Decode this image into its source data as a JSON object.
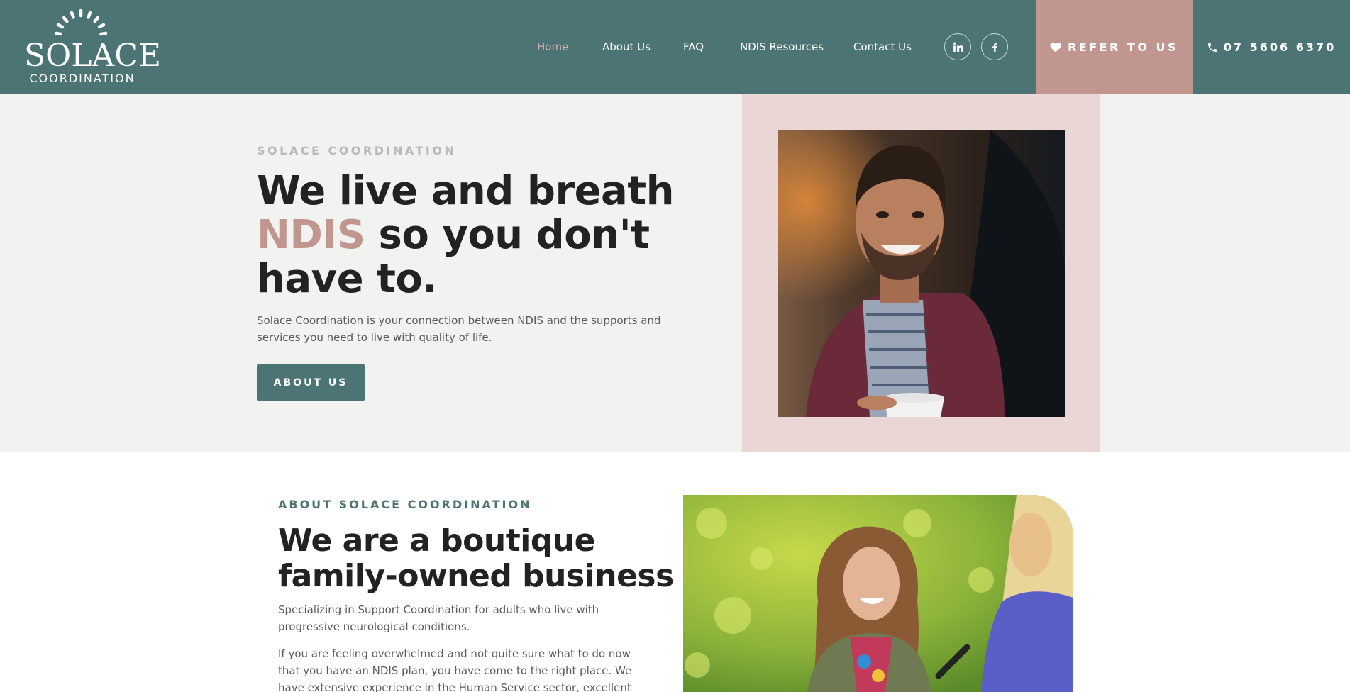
{
  "header": {
    "logo": {
      "word": "SOLACE",
      "sub": "COORDINATION"
    },
    "nav": [
      {
        "label": "Home",
        "active": true
      },
      {
        "label": "About Us",
        "active": false
      },
      {
        "label": "FAQ",
        "active": false
      },
      {
        "label": "NDIS Resources",
        "active": false
      },
      {
        "label": "Contact Us",
        "active": false
      }
    ],
    "social": [
      {
        "icon": "linkedin-icon",
        "label": "in"
      },
      {
        "icon": "facebook-icon",
        "label": "f"
      }
    ],
    "refer_label": "REFER TO US",
    "phone_label": "07 5606 6370"
  },
  "hero": {
    "eyebrow": "SOLACE COORDINATION",
    "title_line1": "We live and breath",
    "title_accent": "NDIS",
    "title_rest": " so you don't have to.",
    "description": "Solace Coordination is your connection between NDIS and the supports and services you need to live with quality of life.",
    "button_label": "ABOUT US"
  },
  "about": {
    "eyebrow": "ABOUT SOLACE COORDINATION",
    "title": "We are a boutique family-owned business",
    "p1": "Specializing in Support Coordination for adults who live with progressive neurological conditions.",
    "p2": "If you are feeling overwhelmed and not quite sure what to do now that you have an NDIS plan, you have come to the right place. We have extensive experience in the Human Service sector, excellent local"
  },
  "colors": {
    "teal": "#4d7474",
    "rose": "#c0968e",
    "pink_panel": "#ead6d4",
    "hero_bg": "#f2f2f1"
  }
}
